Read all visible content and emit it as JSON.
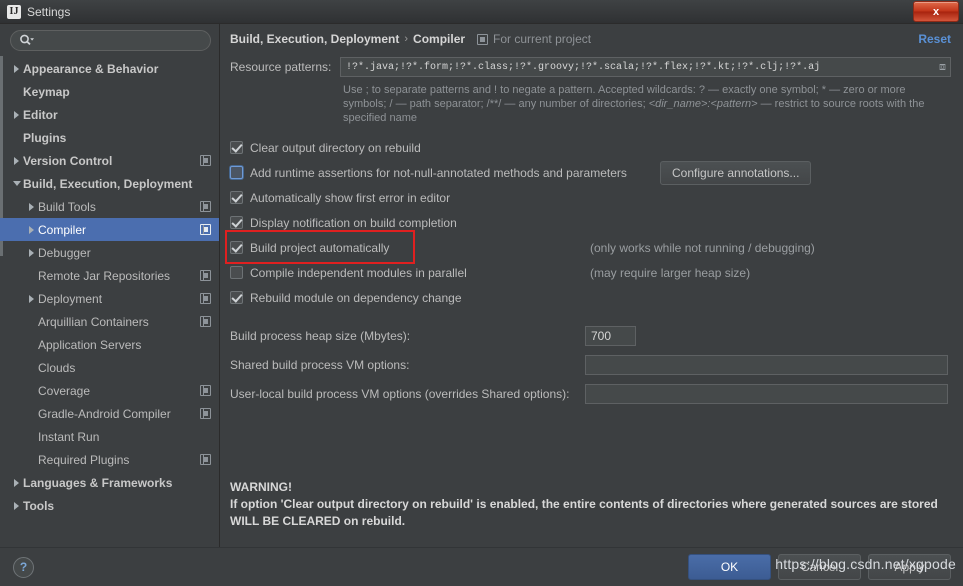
{
  "window": {
    "title": "Settings",
    "app_badge": "IJ",
    "close_label": "x"
  },
  "sidebar": {
    "search": {
      "value": "",
      "placeholder": ""
    },
    "items": [
      {
        "label": "Appearance & Behavior",
        "arrow": "right",
        "indent": 0,
        "bold": true,
        "project_icon": false,
        "selected": false
      },
      {
        "label": "Keymap",
        "arrow": "none",
        "indent": 0,
        "bold": true,
        "project_icon": false,
        "selected": false
      },
      {
        "label": "Editor",
        "arrow": "right",
        "indent": 0,
        "bold": true,
        "project_icon": false,
        "selected": false
      },
      {
        "label": "Plugins",
        "arrow": "none",
        "indent": 0,
        "bold": true,
        "project_icon": false,
        "selected": false
      },
      {
        "label": "Version Control",
        "arrow": "right",
        "indent": 0,
        "bold": true,
        "project_icon": true,
        "selected": false
      },
      {
        "label": "Build, Execution, Deployment",
        "arrow": "down",
        "indent": 0,
        "bold": true,
        "project_icon": false,
        "selected": false
      },
      {
        "label": "Build Tools",
        "arrow": "right",
        "indent": 1,
        "bold": false,
        "project_icon": true,
        "selected": false
      },
      {
        "label": "Compiler",
        "arrow": "right",
        "indent": 1,
        "bold": false,
        "project_icon": true,
        "selected": true
      },
      {
        "label": "Debugger",
        "arrow": "right",
        "indent": 1,
        "bold": false,
        "project_icon": false,
        "selected": false
      },
      {
        "label": "Remote Jar Repositories",
        "arrow": "none",
        "indent": 1,
        "bold": false,
        "project_icon": true,
        "selected": false
      },
      {
        "label": "Deployment",
        "arrow": "right",
        "indent": 1,
        "bold": false,
        "project_icon": true,
        "selected": false
      },
      {
        "label": "Arquillian Containers",
        "arrow": "none",
        "indent": 1,
        "bold": false,
        "project_icon": true,
        "selected": false
      },
      {
        "label": "Application Servers",
        "arrow": "none",
        "indent": 1,
        "bold": false,
        "project_icon": false,
        "selected": false
      },
      {
        "label": "Clouds",
        "arrow": "none",
        "indent": 1,
        "bold": false,
        "project_icon": false,
        "selected": false
      },
      {
        "label": "Coverage",
        "arrow": "none",
        "indent": 1,
        "bold": false,
        "project_icon": true,
        "selected": false
      },
      {
        "label": "Gradle-Android Compiler",
        "arrow": "none",
        "indent": 1,
        "bold": false,
        "project_icon": true,
        "selected": false
      },
      {
        "label": "Instant Run",
        "arrow": "none",
        "indent": 1,
        "bold": false,
        "project_icon": false,
        "selected": false
      },
      {
        "label": "Required Plugins",
        "arrow": "none",
        "indent": 1,
        "bold": false,
        "project_icon": true,
        "selected": false
      },
      {
        "label": "Languages & Frameworks",
        "arrow": "right",
        "indent": 0,
        "bold": true,
        "project_icon": false,
        "selected": false
      },
      {
        "label": "Tools",
        "arrow": "right",
        "indent": 0,
        "bold": true,
        "project_icon": false,
        "selected": false
      }
    ]
  },
  "header": {
    "crumb_parent": "Build, Execution, Deployment",
    "crumb_sep": "›",
    "crumb_current": "Compiler",
    "scope_text": "For current project",
    "reset_label": "Reset"
  },
  "main": {
    "resource_patterns": {
      "label": "Resource patterns:",
      "value": "!?*.java;!?*.form;!?*.class;!?*.groovy;!?*.scala;!?*.flex;!?*.kt;!?*.clj;!?*.aj",
      "hint_part1": "Use ; to separate patterns and ! to negate a pattern. Accepted wildcards: ? — exactly one symbol; * — zero or more symbols; / — path separator; /**/ — any number of directories; ",
      "hint_italic1": "<dir_name>:<pattern>",
      "hint_part2": " — restrict to source roots with the specified name"
    },
    "checkboxes": [
      {
        "label": "Clear output directory on rebuild",
        "checked": true,
        "focused": false,
        "note": "",
        "highlighted": false
      },
      {
        "label": "Add runtime assertions for not-null-annotated methods and parameters",
        "checked": false,
        "focused": true,
        "note": "",
        "highlighted": false,
        "button": "Configure annotations..."
      },
      {
        "label": "Automatically show first error in editor",
        "checked": true,
        "focused": false,
        "note": "",
        "highlighted": false
      },
      {
        "label": "Display notification on build completion",
        "checked": true,
        "focused": false,
        "note": "",
        "highlighted": false
      },
      {
        "label": "Build project automatically",
        "checked": true,
        "focused": false,
        "note": "(only works while not running / debugging)",
        "highlighted": true
      },
      {
        "label": "Compile independent modules in parallel",
        "checked": false,
        "focused": false,
        "note": "(may require larger heap size)",
        "highlighted": false
      },
      {
        "label": "Rebuild module on dependency change",
        "checked": true,
        "focused": false,
        "note": "",
        "highlighted": false
      }
    ],
    "fields": [
      {
        "label": "Build process heap size (Mbytes):",
        "value": "700",
        "size": "small"
      },
      {
        "label": "Shared build process VM options:",
        "value": "",
        "size": "wide"
      },
      {
        "label": "User-local build process VM options (overrides Shared options):",
        "value": "",
        "size": "widest"
      }
    ],
    "warning": {
      "title": "WARNING!",
      "line1": "If option 'Clear output directory on rebuild' is enabled, the entire contents of directories where generated sources are stored",
      "line2": "WILL BE CLEARED on rebuild."
    }
  },
  "footer": {
    "help_label": "?",
    "ok_label": "OK",
    "cancel_label": "Cancel",
    "apply_label": "Apply",
    "watermark": "https://blog.csdn.net/xgpode"
  },
  "colors": {
    "accent": "#4b6eaf",
    "link": "#5a91d6",
    "highlight_box": "#e02020",
    "background": "#3c3f41",
    "field_bg": "#45494a"
  }
}
